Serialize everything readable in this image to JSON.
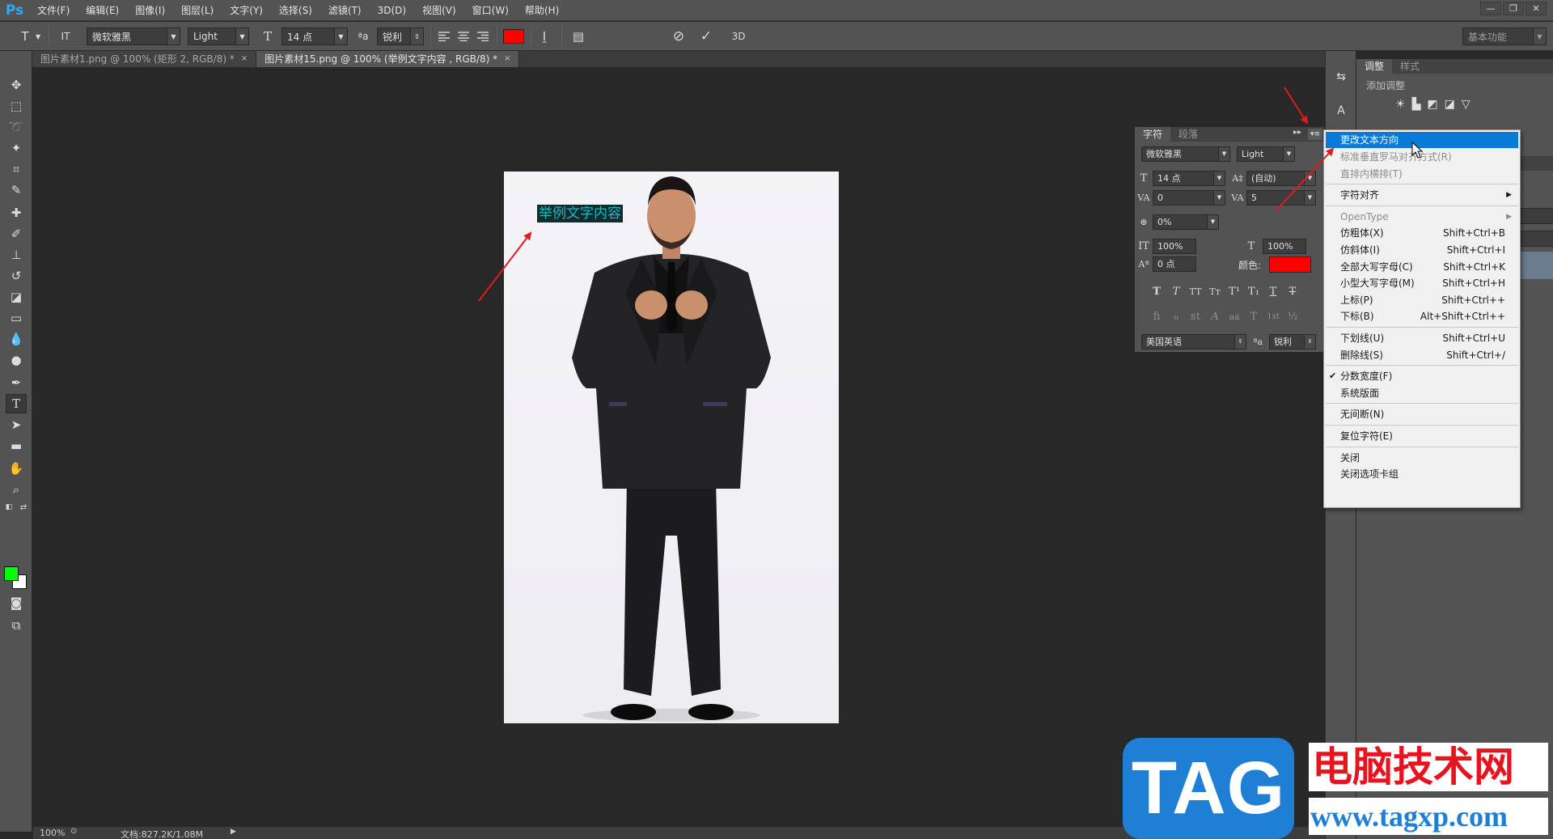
{
  "app": {
    "logo": "Ps",
    "menus": [
      "文件(F)",
      "编辑(E)",
      "图像(I)",
      "图层(L)",
      "文字(Y)",
      "选择(S)",
      "滤镜(T)",
      "3D(D)",
      "视图(V)",
      "窗口(W)",
      "帮助(H)"
    ],
    "window_buttons": [
      "—",
      "❐",
      "✕"
    ]
  },
  "options_bar": {
    "tool_icon": "T",
    "orient_icon": "IT",
    "font_family": "微软雅黑",
    "font_style": "Light",
    "size_icon": "T",
    "font_size": "14 点",
    "aa_icon": "ªa",
    "antialias": "锐利",
    "text_color": "#ff0000",
    "warp_icon": "I̱",
    "panel_icon": "▤",
    "cancel_icon": "⊘",
    "commit_icon": "✓",
    "three_d": "3D",
    "workspace": "基本功能"
  },
  "tabs": [
    {
      "label": "图片素材1.png @ 100% (矩形 2, RGB/8) *",
      "close": "×"
    },
    {
      "label": "图片素材15.png @ 100% (举例文字内容 , RGB/8) *",
      "close": "×"
    }
  ],
  "document": {
    "text_layer": "举例文字内容"
  },
  "status": {
    "zoom": "100%",
    "doc_info": "文档:827.2K/1.08M",
    "play_icon": "▶"
  },
  "tools": {
    "fg_color": "#00ff00",
    "bg_color": "#ffffff"
  },
  "right_panel": {
    "tabs": [
      "调整",
      "样式"
    ],
    "title": "添加调整"
  },
  "char_panel": {
    "tabs": [
      "字符",
      "段落"
    ],
    "font_family": "微软雅黑",
    "font_style": "Light",
    "size": "14 点",
    "leading": "(自动)",
    "kerning": "0",
    "tracking": "5",
    "tsume": "0%",
    "vscale": "100%",
    "hscale": "100%",
    "baseline": "0 点",
    "color_label": "颜色:",
    "color": "#ff0000",
    "language": "美国英语",
    "aa_icon": "ªa",
    "antialias": "锐利",
    "style_buttons": [
      "T",
      "T",
      "TT",
      "Tт",
      "T¹",
      "T₁",
      "T",
      "T"
    ],
    "opentype_buttons": [
      "fi",
      "ℴ",
      "st",
      "A",
      "aa",
      "T",
      "1st",
      "½"
    ]
  },
  "context_menu": {
    "items": [
      {
        "label": "更改文本方向",
        "shortcut": "",
        "state": "selected"
      },
      {
        "label": "标准垂直罗马对齐方式(R)",
        "shortcut": "",
        "state": "disabled"
      },
      {
        "label": "直排内横排(T)",
        "shortcut": "",
        "state": "disabled"
      },
      {
        "label": "字符对齐",
        "shortcut": "",
        "state": "submenu"
      },
      {
        "label": "OpenType",
        "shortcut": "",
        "state": "disabled-submenu"
      },
      {
        "label": "仿粗体(X)",
        "shortcut": "Shift+Ctrl+B",
        "state": "normal"
      },
      {
        "label": "仿斜体(I)",
        "shortcut": "Shift+Ctrl+I",
        "state": "normal"
      },
      {
        "label": "全部大写字母(C)",
        "shortcut": "Shift+Ctrl+K",
        "state": "normal"
      },
      {
        "label": "小型大写字母(M)",
        "shortcut": "Shift+Ctrl+H",
        "state": "normal"
      },
      {
        "label": "上标(P)",
        "shortcut": "Shift+Ctrl++",
        "state": "normal"
      },
      {
        "label": "下标(B)",
        "shortcut": "Alt+Shift+Ctrl++",
        "state": "normal"
      },
      {
        "label": "下划线(U)",
        "shortcut": "Shift+Ctrl+U",
        "state": "normal"
      },
      {
        "label": "删除线(S)",
        "shortcut": "Shift+Ctrl+/",
        "state": "normal"
      },
      {
        "label": "分数宽度(F)",
        "shortcut": "",
        "state": "checked"
      },
      {
        "label": "系统版面",
        "shortcut": "",
        "state": "normal"
      },
      {
        "label": "无间断(N)",
        "shortcut": "",
        "state": "normal"
      },
      {
        "label": "复位字符(E)",
        "shortcut": "",
        "state": "normal"
      },
      {
        "label": "关闭",
        "shortcut": "",
        "state": "normal"
      },
      {
        "label": "关闭选项卡组",
        "shortcut": "",
        "state": "normal"
      }
    ]
  },
  "watermark": {
    "tag": "TAG",
    "name": "电脑技术网",
    "url": "www.tagxp.com"
  },
  "colors": {
    "annotation_arrow": "#e01b1b",
    "menu_highlight": "#0a7ad8"
  }
}
